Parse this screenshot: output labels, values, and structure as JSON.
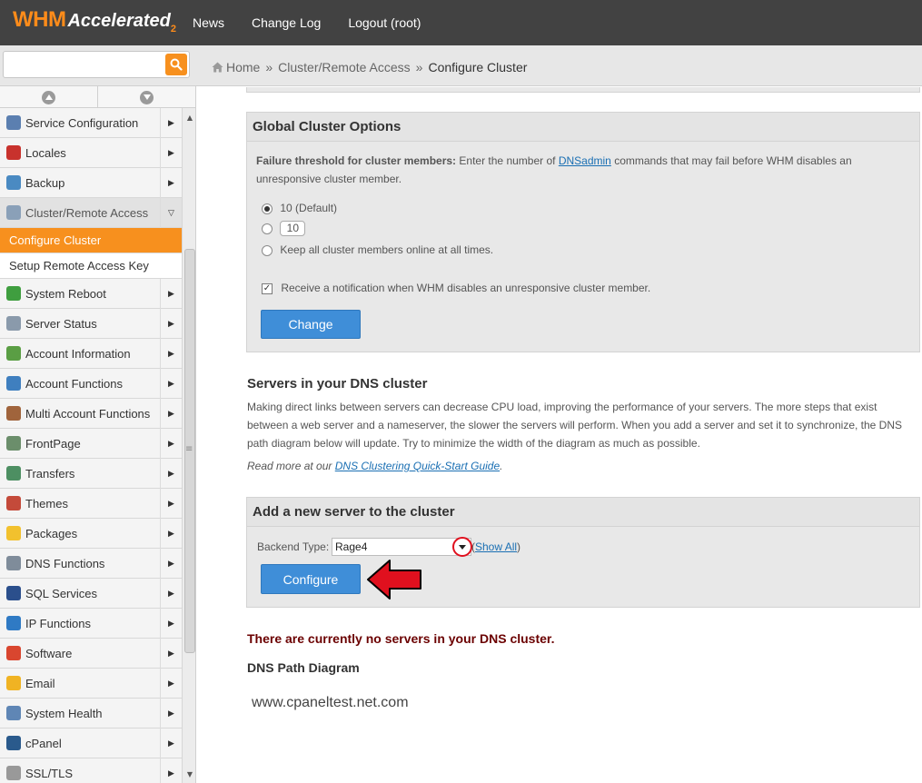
{
  "header": {
    "logo_whm": "WHM",
    "logo_accelerated": "Accelerated",
    "logo_sub": "2",
    "nav": [
      "News",
      "Change Log",
      "Logout (root)"
    ]
  },
  "search": {
    "value": "",
    "placeholder": ""
  },
  "breadcrumb": {
    "home": "Home",
    "section": "Cluster/Remote Access",
    "current": "Configure Cluster"
  },
  "sidebar": {
    "items_before": [
      {
        "label": "Service Configuration",
        "icon": "gears-icon",
        "color": "#5b7fb0"
      },
      {
        "label": "Locales",
        "icon": "flag-icon",
        "color": "#c8322d"
      },
      {
        "label": "Backup",
        "icon": "backup-icon",
        "color": "#4a8ac2"
      }
    ],
    "open_item": {
      "label": "Cluster/Remote Access",
      "icon": "cluster-icon",
      "color": "#8aa0b8"
    },
    "sub_items": [
      {
        "label": "Configure Cluster",
        "active": true
      },
      {
        "label": "Setup Remote Access Key",
        "active": false
      }
    ],
    "items_after": [
      {
        "label": "System Reboot",
        "icon": "power-icon",
        "color": "#3f9e3f"
      },
      {
        "label": "Server Status",
        "icon": "server-icon",
        "color": "#8a9aab"
      },
      {
        "label": "Account Information",
        "icon": "account-info-icon",
        "color": "#5a9e44"
      },
      {
        "label": "Account Functions",
        "icon": "account-functions-icon",
        "color": "#3f7fbf"
      },
      {
        "label": "Multi Account Functions",
        "icon": "users-icon",
        "color": "#a0643c"
      },
      {
        "label": "FrontPage",
        "icon": "frontpage-icon",
        "color": "#6b8e6b"
      },
      {
        "label": "Transfers",
        "icon": "transfer-icon",
        "color": "#4d8f62"
      },
      {
        "label": "Themes",
        "icon": "themes-icon",
        "color": "#c44a3a"
      },
      {
        "label": "Packages",
        "icon": "package-icon",
        "color": "#f2c12e"
      },
      {
        "label": "DNS Functions",
        "icon": "dns-icon",
        "color": "#7f8c9a"
      },
      {
        "label": "SQL Services",
        "icon": "database-icon",
        "color": "#2b4f8c"
      },
      {
        "label": "IP Functions",
        "icon": "globe-icon",
        "color": "#2f7ac4"
      },
      {
        "label": "Software",
        "icon": "software-icon",
        "color": "#d9462f"
      },
      {
        "label": "Email",
        "icon": "email-icon",
        "color": "#f0b323"
      },
      {
        "label": "System Health",
        "icon": "health-icon",
        "color": "#5f86b5"
      },
      {
        "label": "cPanel",
        "icon": "cpanel-icon",
        "color": "#2a5a8c"
      },
      {
        "label": "SSL/TLS",
        "icon": "lock-icon",
        "color": "#999999"
      }
    ]
  },
  "global_options": {
    "title": "Global Cluster Options",
    "threshold_label": "Failure threshold for cluster members:",
    "threshold_text_pre": "Enter the number of",
    "threshold_link": "DNSadmin",
    "threshold_text_post": "commands that may fail before WHM disables an unresponsive cluster member.",
    "radio_default": "10 (Default)",
    "radio_custom_value": "10",
    "radio_online": "Keep all cluster members online at all times.",
    "notify_label": "Receive a notification when WHM disables an unresponsive cluster member.",
    "change_button": "Change"
  },
  "servers_section": {
    "title": "Servers in your DNS cluster",
    "description": "Making direct links between servers can decrease CPU load, improving the performance of your servers. The more steps that exist between a web server and a nameserver, the slower the servers will perform. When you add a server and set it to synchronize, the DNS path diagram below will update. Try to minimize the width of the diagram as much as possible.",
    "read_more_pre": "Read more at our",
    "read_more_link": "DNS Clustering Quick-Start Guide",
    "read_more_post": "."
  },
  "add_server": {
    "title": "Add a new server to the cluster",
    "backend_label": "Backend Type:",
    "backend_value": "Rage4",
    "show_all_open": "(",
    "show_all": "Show All",
    "show_all_close": ")",
    "configure_button": "Configure"
  },
  "no_servers_message": "There are currently no servers in your DNS cluster.",
  "dns_diagram": {
    "title": "DNS Path Diagram",
    "host": "www.cpaneltest.net.com"
  },
  "colors": {
    "accent": "#f7901e",
    "button_blue": "#3f8ed8",
    "alert_text": "#6b0000",
    "annotation_red": "#e0101e"
  }
}
